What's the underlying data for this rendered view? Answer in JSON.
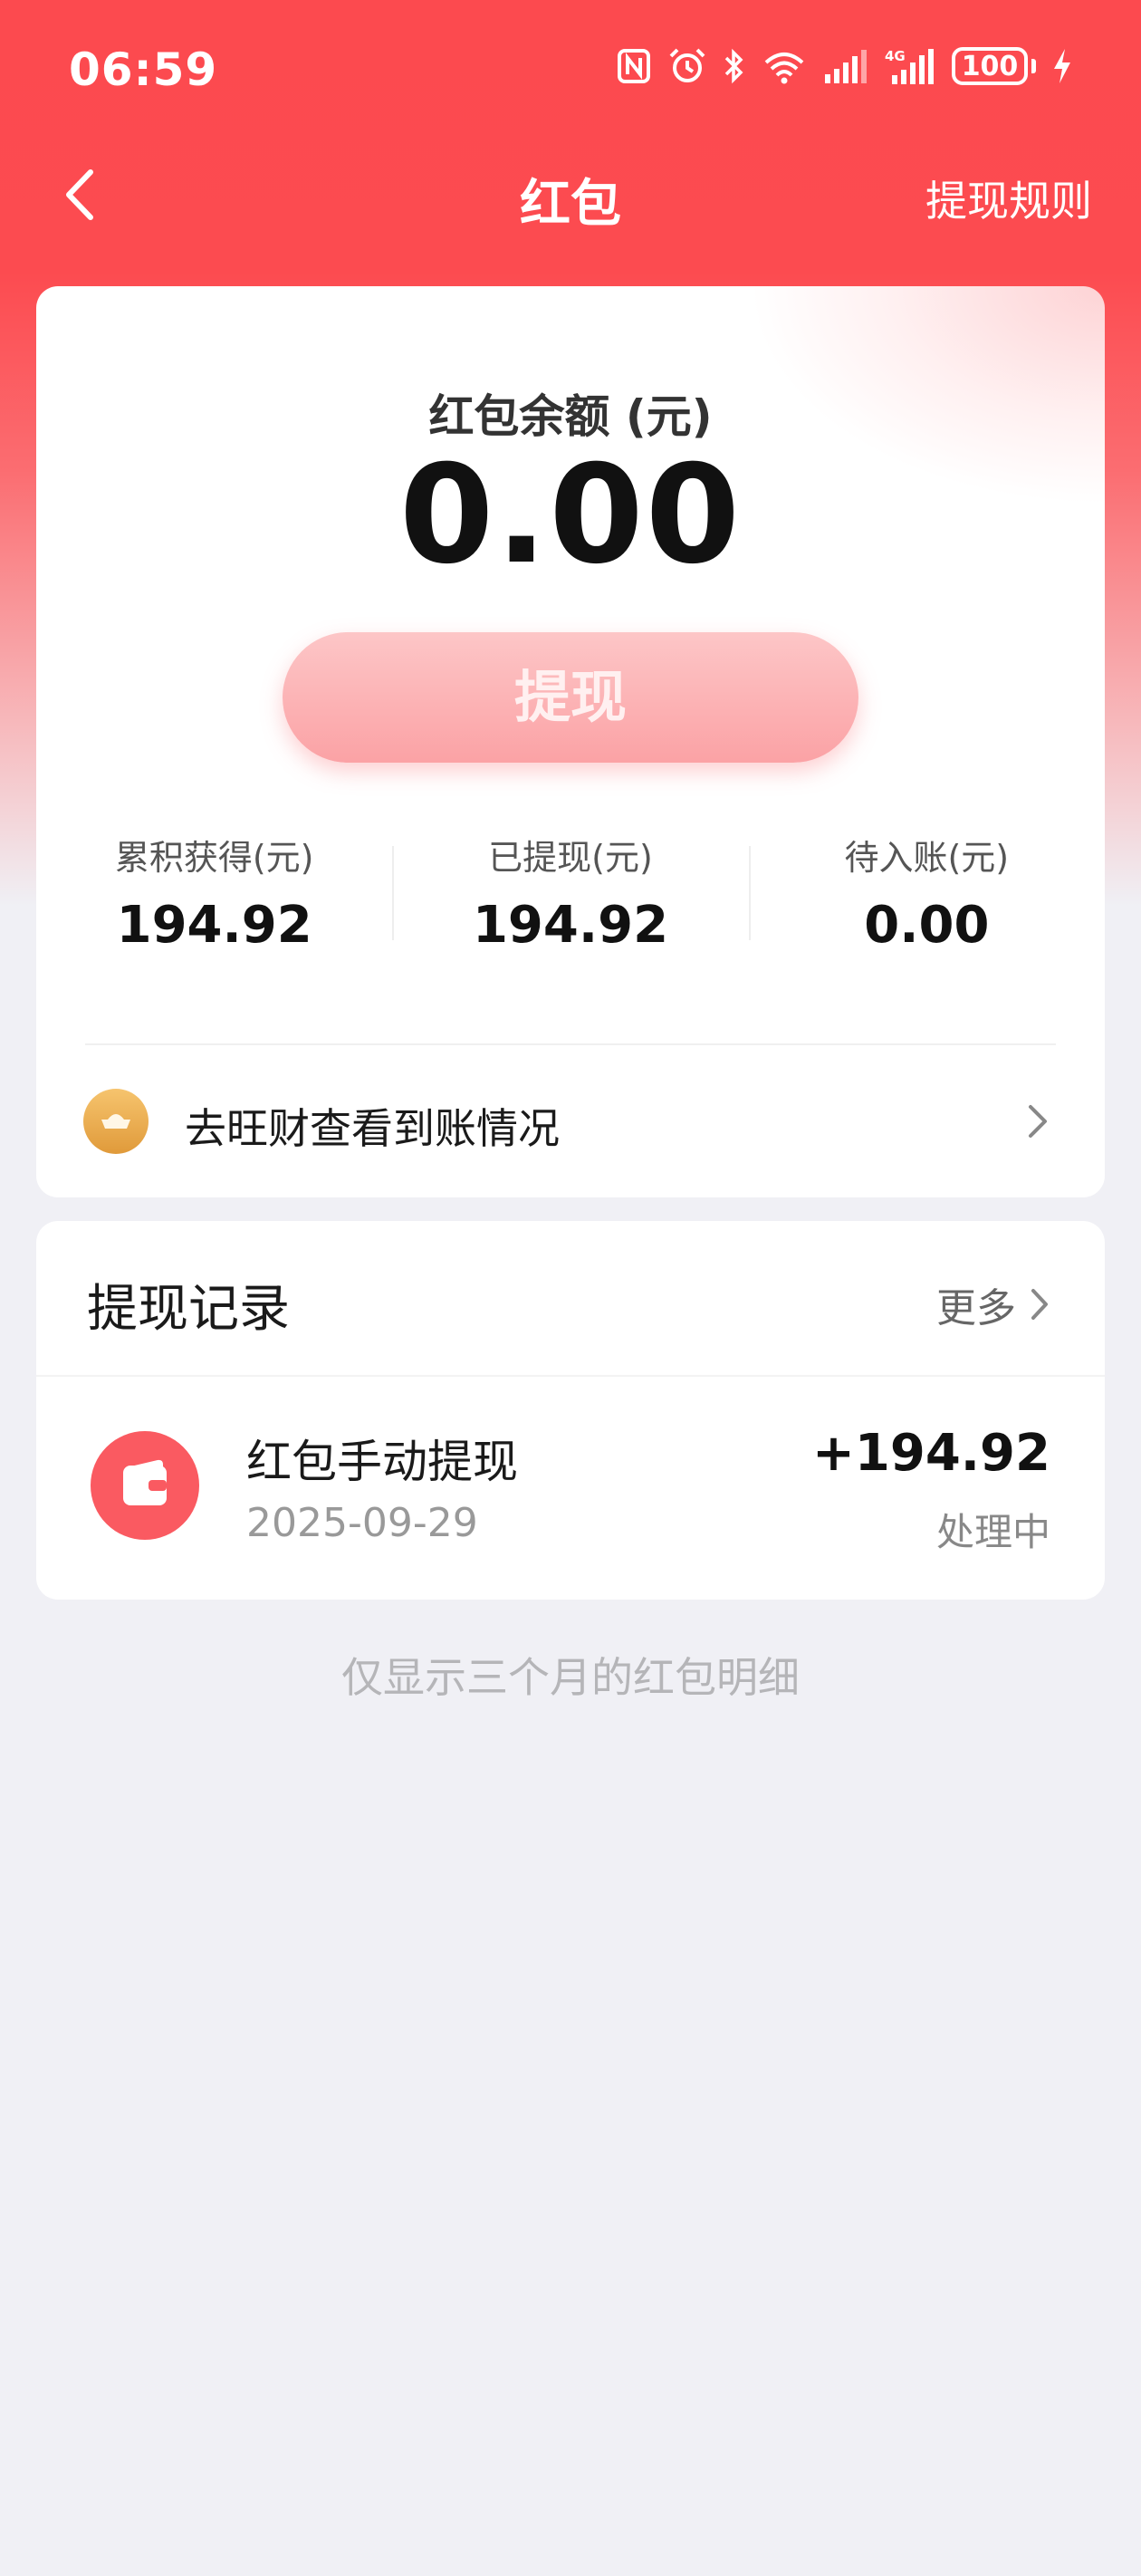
{
  "status_bar": {
    "time": "06:59",
    "battery": "100",
    "icons": [
      "nfc-icon",
      "alarm-icon",
      "bluetooth-icon",
      "wifi-icon",
      "signal-icon",
      "signal-4g-icon",
      "battery-icon",
      "charging-icon"
    ]
  },
  "nav": {
    "title": "红包",
    "right_link": "提现规则"
  },
  "balance": {
    "label": "红包余额 (元)",
    "value": "0.00",
    "withdraw_button": "提现"
  },
  "stats": [
    {
      "label": "累积获得(元)",
      "value": "194.92"
    },
    {
      "label": "已提现(元)",
      "value": "194.92"
    },
    {
      "label": "待入账(元)",
      "value": "0.00"
    }
  ],
  "wangcai": {
    "text": "去旺财查看到账情况"
  },
  "records": {
    "title": "提现记录",
    "more": "更多",
    "items": [
      {
        "title": "红包手动提现",
        "date": "2025-09-29",
        "amount": "+194.92",
        "status": "处理中"
      }
    ]
  },
  "footer_note": "仅显示三个月的红包明细",
  "colors": {
    "brand_red": "#fc4a4f",
    "button_pink": "#fba2a5",
    "page_bg": "#f0f0f5"
  }
}
